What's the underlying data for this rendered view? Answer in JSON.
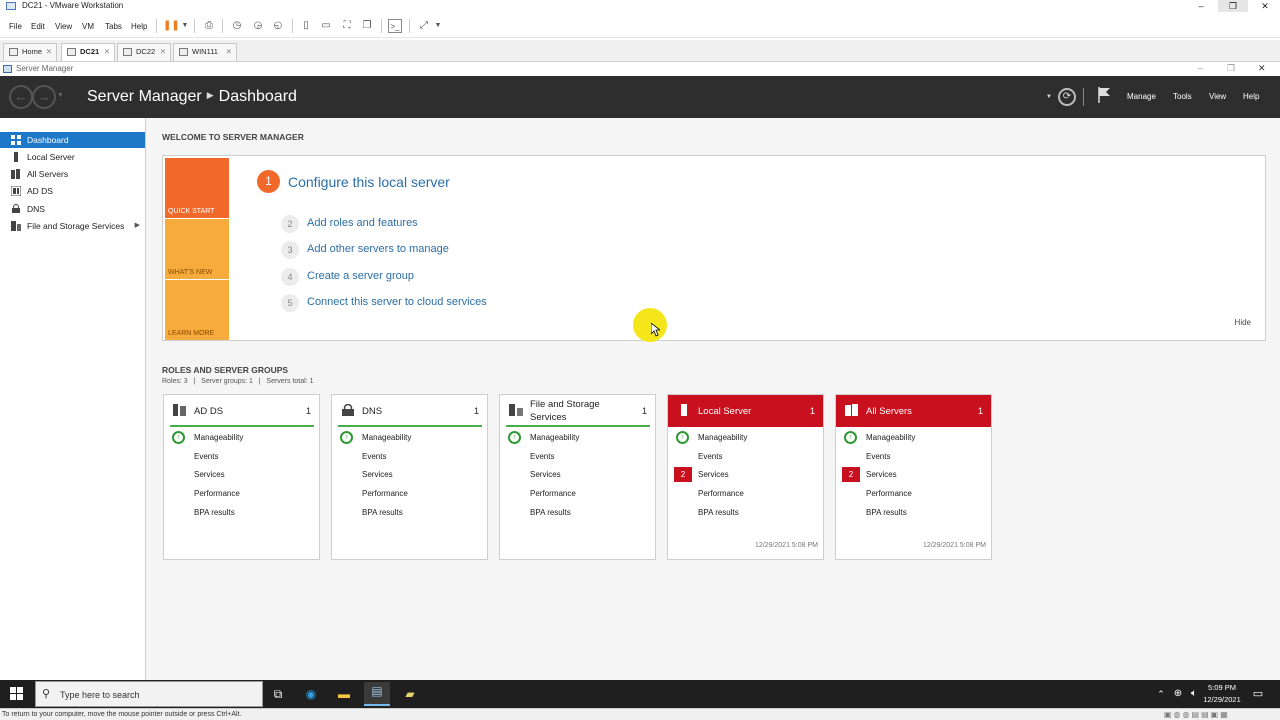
{
  "vmware": {
    "title": "DC21 - VMware Workstation",
    "menu": [
      "File",
      "Edit",
      "View",
      "VM",
      "Tabs",
      "Help"
    ],
    "tabs": [
      {
        "label": "Home",
        "active": false
      },
      {
        "label": "DC21",
        "active": true
      },
      {
        "label": "DC22",
        "active": false
      },
      {
        "label": "WIN111",
        "active": false
      }
    ],
    "status_text": "To return to your computer, move the mouse pointer outside or press Ctrl+Alt."
  },
  "server_manager": {
    "window_title": "Server Manager",
    "breadcrumb_app": "Server Manager",
    "breadcrumb_page": "Dashboard",
    "header_menu": [
      "Manage",
      "Tools",
      "View",
      "Help"
    ]
  },
  "sidebar": {
    "items": [
      {
        "label": "Dashboard",
        "icon": "dashboard-icon",
        "active": true
      },
      {
        "label": "Local Server",
        "icon": "server-icon",
        "active": false
      },
      {
        "label": "All Servers",
        "icon": "servers-icon",
        "active": false
      },
      {
        "label": "AD DS",
        "icon": "adds-icon",
        "active": false
      },
      {
        "label": "DNS",
        "icon": "dns-icon",
        "active": false
      },
      {
        "label": "File and Storage Services",
        "icon": "storage-icon",
        "active": false,
        "has_submenu": true
      }
    ]
  },
  "welcome": {
    "heading": "WELCOME TO SERVER MANAGER",
    "tiles": [
      "QUICK START",
      "WHAT'S NEW",
      "LEARN MORE"
    ],
    "steps": [
      {
        "num": "1",
        "label": "Configure this local server"
      },
      {
        "num": "2",
        "label": "Add roles and features"
      },
      {
        "num": "3",
        "label": "Add other servers to manage"
      },
      {
        "num": "4",
        "label": "Create a server group"
      },
      {
        "num": "5",
        "label": "Connect this server to cloud services"
      }
    ],
    "hide_label": "Hide"
  },
  "roles": {
    "heading": "ROLES AND SERVER GROUPS",
    "summary": "Roles: 3   |   Server groups: 1   |   Servers total: 1",
    "tiles": [
      {
        "name": "AD DS",
        "count": "1",
        "status": "ok",
        "services_alert": "",
        "timestamp": ""
      },
      {
        "name": "DNS",
        "count": "1",
        "status": "ok",
        "services_alert": "",
        "timestamp": ""
      },
      {
        "name": "File and Storage Services",
        "name_line1": "File and Storage",
        "name_line2": "Services",
        "count": "1",
        "status": "ok",
        "services_alert": "",
        "timestamp": ""
      },
      {
        "name": "Local Server",
        "count": "1",
        "status": "alert",
        "services_alert": "2",
        "timestamp": "12/29/2021 5:08 PM"
      },
      {
        "name": "All Servers",
        "count": "1",
        "status": "alert",
        "services_alert": "2",
        "timestamp": "12/29/2021 5:08 PM"
      }
    ],
    "rows": [
      "Manageability",
      "Events",
      "Services",
      "Performance",
      "BPA results"
    ]
  },
  "taskbar": {
    "search_placeholder": "Type here to search",
    "time": "5:09 PM",
    "date": "12/29/2021"
  },
  "colors": {
    "header_bg": "#2e2e2e",
    "accent_blue": "#1e78c8",
    "quick_start": "#f0692a",
    "whats_new": "#f6ab3c",
    "learn_more": "#f6ab3c",
    "alert_red": "#c9101e",
    "ok_green": "#45b049"
  }
}
